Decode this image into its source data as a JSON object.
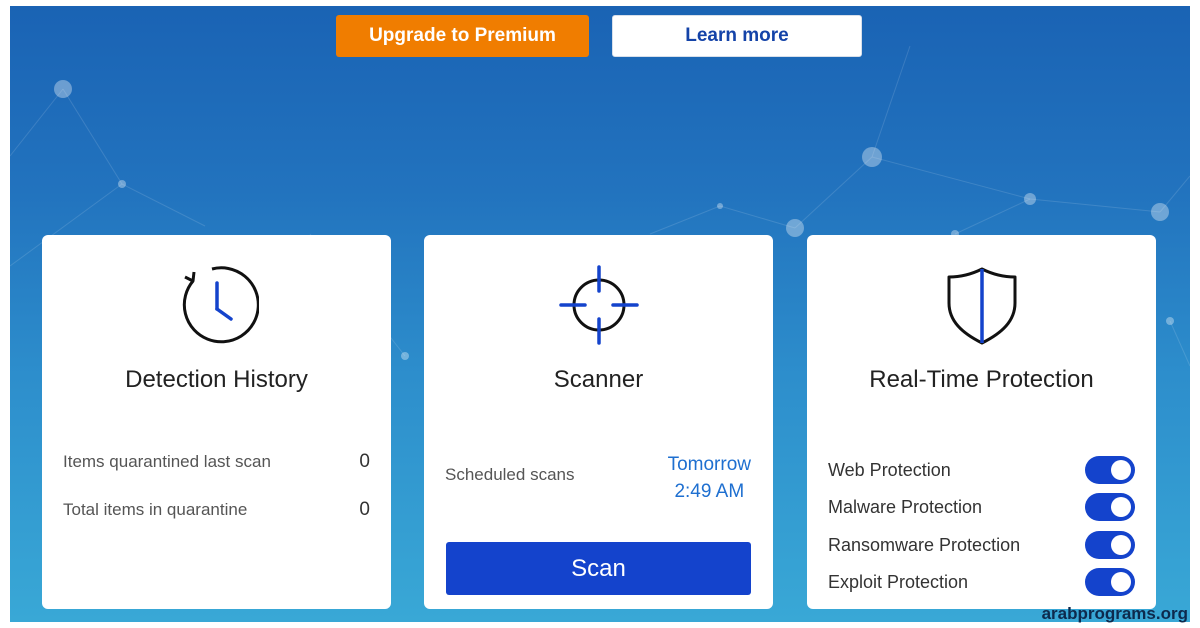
{
  "header": {
    "upgrade_label": "Upgrade to Premium",
    "learn_more_label": "Learn more"
  },
  "cards": {
    "detection_history": {
      "title": "Detection History",
      "icon": "history-clock-icon",
      "stats": [
        {
          "label": "Items quarantined last scan",
          "value": "0"
        },
        {
          "label": "Total items in quarantine",
          "value": "0"
        }
      ]
    },
    "scanner": {
      "title": "Scanner",
      "icon": "crosshair-icon",
      "scheduled_label": "Scheduled scans",
      "scheduled_day": "Tomorrow",
      "scheduled_time": "2:49 AM",
      "scan_label": "Scan"
    },
    "real_time_protection": {
      "title": "Real-Time Protection",
      "icon": "shield-icon",
      "toggles": [
        {
          "label": "Web Protection",
          "on": true
        },
        {
          "label": "Malware Protection",
          "on": true
        },
        {
          "label": "Ransomware Protection",
          "on": true
        },
        {
          "label": "Exploit Protection",
          "on": true
        }
      ]
    }
  },
  "watermark": "arabprograms.org",
  "colors": {
    "accent_blue": "#1443cc",
    "upgrade_orange": "#f07d00",
    "schedule_blue": "#1e6fd0"
  }
}
